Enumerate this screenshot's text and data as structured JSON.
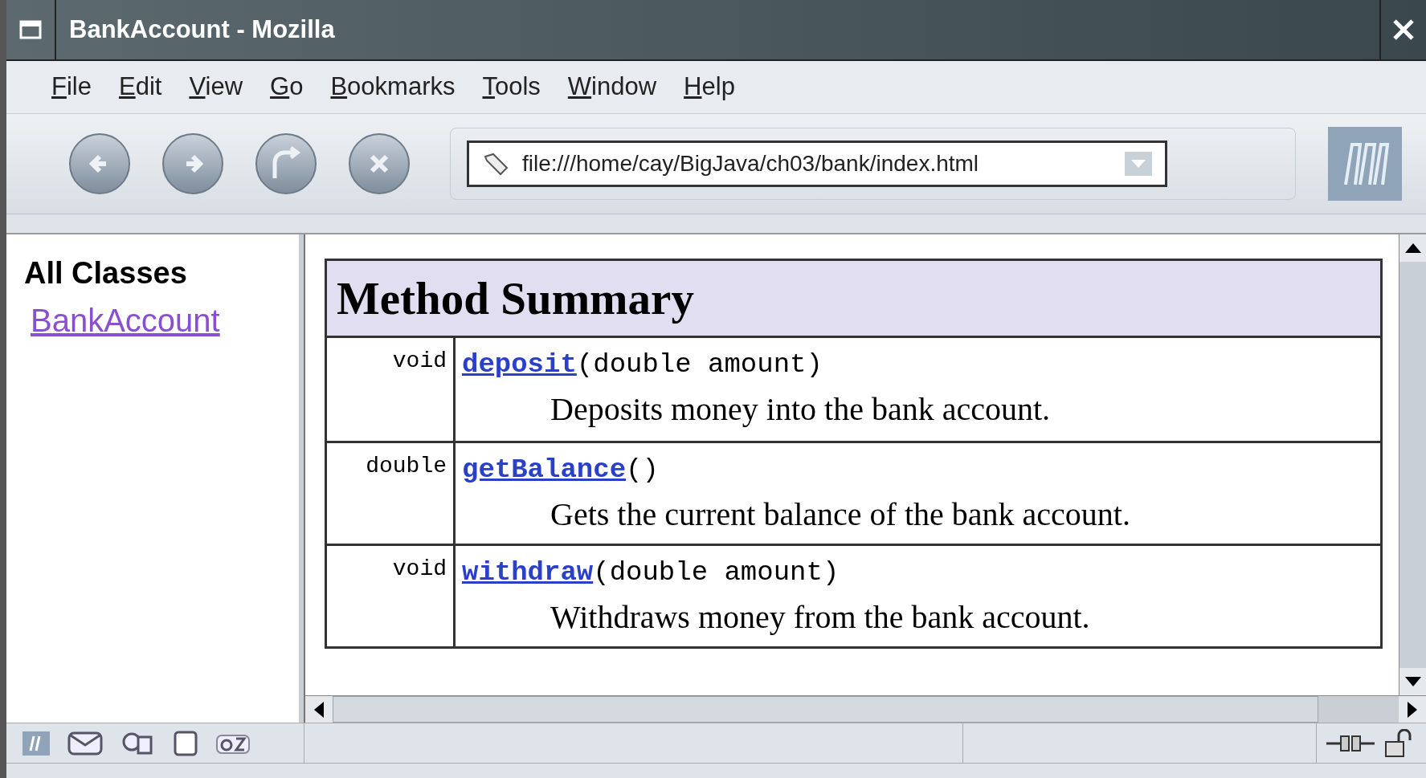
{
  "window": {
    "title": "BankAccount - Mozilla"
  },
  "menu": [
    {
      "label": "File"
    },
    {
      "label": "Edit"
    },
    {
      "label": "View"
    },
    {
      "label": "Go"
    },
    {
      "label": "Bookmarks"
    },
    {
      "label": "Tools"
    },
    {
      "label": "Window"
    },
    {
      "label": "Help"
    }
  ],
  "address": {
    "value": "file:///home/cay/BigJava/ch03/bank/index.html"
  },
  "sidebar": {
    "heading": "All Classes",
    "links": [
      {
        "label": "BankAccount",
        "visited": true
      }
    ]
  },
  "summary": {
    "title": "Method Summary",
    "rows": [
      {
        "type": "void",
        "name": "deposit",
        "params": "(double amount)",
        "description": "Deposits money into the bank account."
      },
      {
        "type": "double",
        "name": "getBalance",
        "params": "()",
        "description": "Gets the current balance of the bank account."
      },
      {
        "type": "void",
        "name": "withdraw",
        "params": "(double amount)",
        "description": "Withdraws money from the bank account."
      }
    ]
  }
}
